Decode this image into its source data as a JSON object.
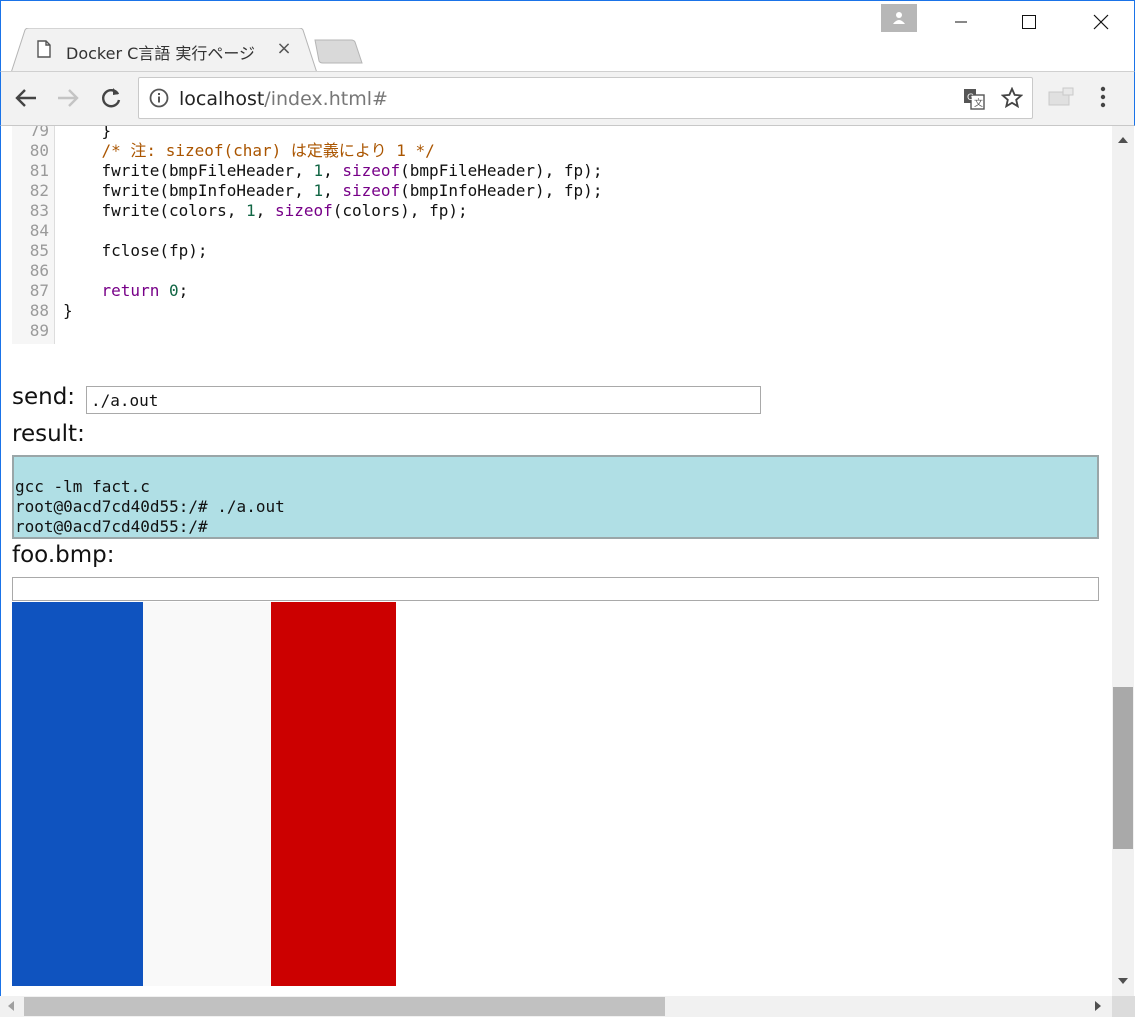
{
  "browser": {
    "tab_title": "Docker C言語 実行ページ",
    "tab_close": "×",
    "url_host": "localhost",
    "url_path": "/index.html#"
  },
  "code": [
    {
      "ln": "79",
      "parts": [
        {
          "t": "    }",
          "c": ""
        }
      ]
    },
    {
      "ln": "80",
      "parts": [
        {
          "t": "    /* 注: sizeof(char) は定義により 1 */",
          "c": "cm"
        }
      ]
    },
    {
      "ln": "81",
      "parts": [
        {
          "t": "    fwrite(bmpFileHeader, ",
          "c": ""
        },
        {
          "t": "1",
          "c": "num"
        },
        {
          "t": ", ",
          "c": ""
        },
        {
          "t": "sizeof",
          "c": "kw"
        },
        {
          "t": "(bmpFileHeader), fp);",
          "c": ""
        }
      ]
    },
    {
      "ln": "82",
      "parts": [
        {
          "t": "    fwrite(bmpInfoHeader, ",
          "c": ""
        },
        {
          "t": "1",
          "c": "num"
        },
        {
          "t": ", ",
          "c": ""
        },
        {
          "t": "sizeof",
          "c": "kw"
        },
        {
          "t": "(bmpInfoHeader), fp);",
          "c": ""
        }
      ]
    },
    {
      "ln": "83",
      "parts": [
        {
          "t": "    fwrite(colors, ",
          "c": ""
        },
        {
          "t": "1",
          "c": "num"
        },
        {
          "t": ", ",
          "c": ""
        },
        {
          "t": "sizeof",
          "c": "kw"
        },
        {
          "t": "(colors), fp);",
          "c": ""
        }
      ]
    },
    {
      "ln": "84",
      "parts": []
    },
    {
      "ln": "85",
      "parts": [
        {
          "t": "    fclose(fp);",
          "c": ""
        }
      ]
    },
    {
      "ln": "86",
      "parts": []
    },
    {
      "ln": "87",
      "parts": [
        {
          "t": "    ",
          "c": ""
        },
        {
          "t": "return",
          "c": "kw"
        },
        {
          "t": " ",
          "c": ""
        },
        {
          "t": "0",
          "c": "num"
        },
        {
          "t": ";",
          "c": ""
        }
      ]
    },
    {
      "ln": "88",
      "parts": [
        {
          "t": "}",
          "c": ""
        }
      ]
    },
    {
      "ln": "89",
      "parts": []
    }
  ],
  "send": {
    "label": "send:",
    "value": "./a.out"
  },
  "result": {
    "label": "result:",
    "text": "gcc -lm fact.c\nroot@0acd7cd40d55:/# ./a.out\nroot@0acd7cd40d55:/#"
  },
  "bmp": {
    "label": "foo.bmp:",
    "stripes": [
      {
        "color": "#0f53bf"
      },
      {
        "color": "#f9f9f9"
      },
      {
        "color": "#cc0000"
      }
    ]
  },
  "colors": {
    "keyword": "#770088",
    "number": "#116644",
    "comment": "#aa5500",
    "result_bg": "#b0dfe5",
    "window_border": "#1a73e8"
  },
  "icons": [
    "document-icon",
    "close-icon",
    "new-tab-icon",
    "profile-icon",
    "minimize-icon",
    "maximize-icon",
    "window-close-icon",
    "back-icon",
    "forward-icon",
    "reload-icon",
    "info-icon",
    "translate-icon",
    "star-icon",
    "extension-icon",
    "menu-icon"
  ]
}
